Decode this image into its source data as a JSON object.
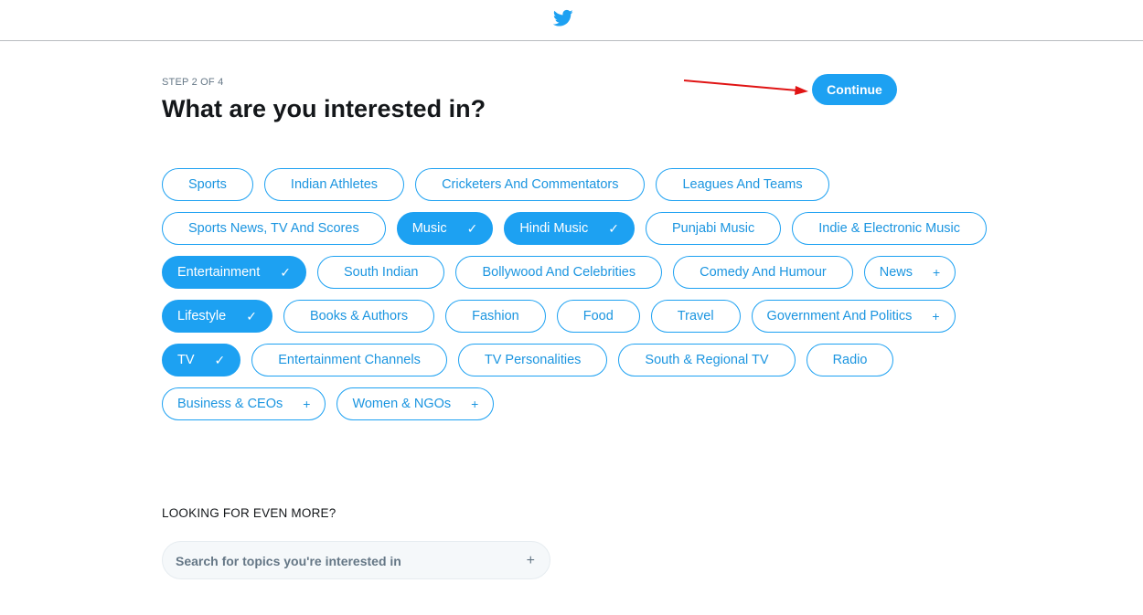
{
  "header": {
    "logo_icon": "twitter-bird-icon"
  },
  "step_label": "STEP 2 OF 4",
  "title": "What are you interested in?",
  "continue_label": "Continue",
  "accent_color": "#1da1f2",
  "annotation_color": "#e01414",
  "chip_rows": [
    [
      {
        "label": "Sports",
        "state": "plain"
      },
      {
        "label": "Indian Athletes",
        "state": "plain"
      },
      {
        "label": "Cricketers And Commentators",
        "state": "plain"
      },
      {
        "label": "Leagues And Teams",
        "state": "plain"
      }
    ],
    [
      {
        "label": "Sports News, TV And Scores",
        "state": "plain"
      },
      {
        "label": "Music",
        "state": "selected",
        "icon": "✓"
      },
      {
        "label": "Hindi Music",
        "state": "selected",
        "icon": "✓"
      },
      {
        "label": "Punjabi Music",
        "state": "plain"
      },
      {
        "label": "Indie & Electronic Music",
        "state": "plain"
      }
    ],
    [
      {
        "label": "Entertainment",
        "state": "selected",
        "icon": "✓"
      },
      {
        "label": "South Indian",
        "state": "plain"
      },
      {
        "label": "Bollywood And Celebrities",
        "state": "plain"
      },
      {
        "label": "Comedy And Humour",
        "state": "plain"
      },
      {
        "label": "News",
        "state": "expandable",
        "icon": "+"
      }
    ],
    [
      {
        "label": "Lifestyle",
        "state": "selected",
        "icon": "✓"
      },
      {
        "label": "Books & Authors",
        "state": "plain"
      },
      {
        "label": "Fashion",
        "state": "plain"
      },
      {
        "label": "Food",
        "state": "plain"
      },
      {
        "label": "Travel",
        "state": "plain"
      },
      {
        "label": "Government And Politics",
        "state": "expandable",
        "icon": "+"
      }
    ],
    [
      {
        "label": "TV",
        "state": "selected",
        "icon": "✓"
      },
      {
        "label": "Entertainment Channels",
        "state": "plain"
      },
      {
        "label": "TV Personalities",
        "state": "plain"
      },
      {
        "label": "South & Regional TV",
        "state": "plain"
      },
      {
        "label": "Radio",
        "state": "plain"
      }
    ],
    [
      {
        "label": "Business & CEOs",
        "state": "expandable",
        "icon": "+"
      },
      {
        "label": "Women & NGOs",
        "state": "expandable",
        "icon": "+"
      }
    ]
  ],
  "more_heading": "LOOKING FOR EVEN MORE?",
  "search": {
    "placeholder": "Search for topics you're interested in",
    "value": "",
    "icon": "+"
  }
}
